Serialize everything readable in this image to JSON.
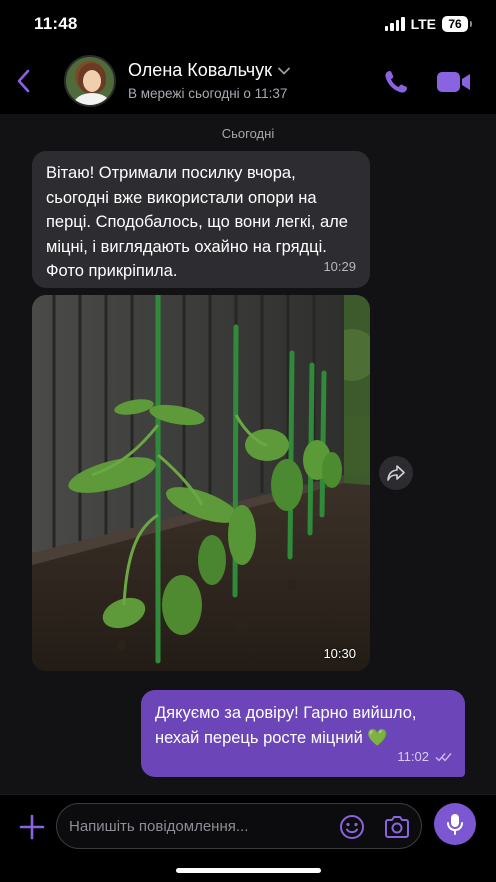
{
  "status_bar": {
    "time": "11:48",
    "network": "LTE",
    "battery": "76"
  },
  "header": {
    "contact_name": "Олена Ковальчук",
    "contact_status": "В мережі сьогодні о 11:37",
    "icons": [
      "back-icon",
      "chevron-down-icon",
      "phone-icon",
      "video-camera-icon"
    ],
    "accent_color": "#7b57d1"
  },
  "chat": {
    "date_label": "Сьогодні",
    "incoming": {
      "text": "Вітаю! Отримали посилку вчора, сьогодні вже використали опори на перці. Сподобалось, що вони легкі, але міцні, і виглядають охайно на грядці. Фото прикріпила.",
      "time": "10:29"
    },
    "photo": {
      "time": "10:30",
      "icon": "forward-icon"
    },
    "outgoing": {
      "text": "Дякуємо за довіру! Гарно вийшло, нехай перець росте міцний 💚",
      "time": "11:02",
      "status_icon": "read-double-check-icon",
      "bubble_color": "#6c46b8"
    }
  },
  "composer": {
    "placeholder": "Напишіть повідомлення...",
    "icons": [
      "plus-icon",
      "emoji-icon",
      "camera-icon",
      "microphone-icon"
    ]
  }
}
